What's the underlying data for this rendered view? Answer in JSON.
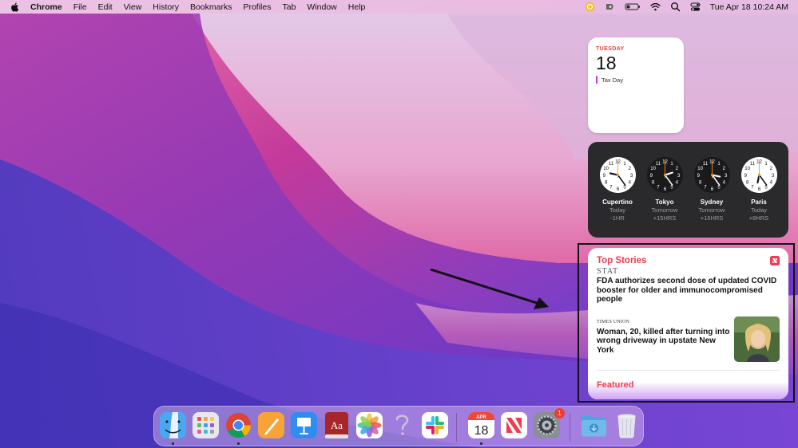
{
  "menubar": {
    "app_name": "Chrome",
    "items": [
      "File",
      "Edit",
      "View",
      "History",
      "Bookmarks",
      "Profiles",
      "Tab",
      "Window",
      "Help"
    ],
    "clock": "Tue Apr 18  10:24 AM"
  },
  "calendar_widget": {
    "weekday": "TUESDAY",
    "day": "18",
    "event": "Tax Day"
  },
  "world_clock_widget": {
    "clocks": [
      {
        "city": "Cupertino",
        "day": "Today",
        "offset": "-1HR",
        "face": "light",
        "hour": 9,
        "minute": 24
      },
      {
        "city": "Tokyo",
        "day": "Tomorrow",
        "offset": "+15HRS",
        "face": "dark",
        "hour": 2,
        "minute": 24
      },
      {
        "city": "Sydney",
        "day": "Tomorrow",
        "offset": "+16HRS",
        "face": "dark",
        "hour": 3,
        "minute": 24
      },
      {
        "city": "Paris",
        "day": "Today",
        "offset": "+8HRS",
        "face": "light",
        "hour": 6,
        "minute": 24
      }
    ]
  },
  "news_widget": {
    "title": "Top Stories",
    "story1": {
      "source": "STAT",
      "headline": "FDA authorizes second dose of updated COVID booster for older and immunocompromised people"
    },
    "story2": {
      "source": "TIMES UNION",
      "headline": "Woman, 20, killed after turning into wrong driveway in upstate New York"
    },
    "next_section": "Featured"
  },
  "dock": {
    "apps": [
      {
        "name": "finder"
      },
      {
        "name": "launchpad"
      },
      {
        "name": "chrome"
      },
      {
        "name": "pages"
      },
      {
        "name": "keynote"
      },
      {
        "name": "dictionary"
      },
      {
        "name": "photos"
      },
      {
        "name": "help"
      },
      {
        "name": "slack"
      },
      {
        "name": "calendar"
      },
      {
        "name": "news"
      },
      {
        "name": "system-preferences"
      },
      {
        "name": "downloads"
      },
      {
        "name": "trash"
      }
    ],
    "calendar_month": "APR",
    "calendar_day": "18",
    "settings_badge": "1"
  },
  "colors": {
    "accent_red": "#f23a4e",
    "calendar_red": "#e0423b",
    "event_purple": "#b53be0"
  }
}
